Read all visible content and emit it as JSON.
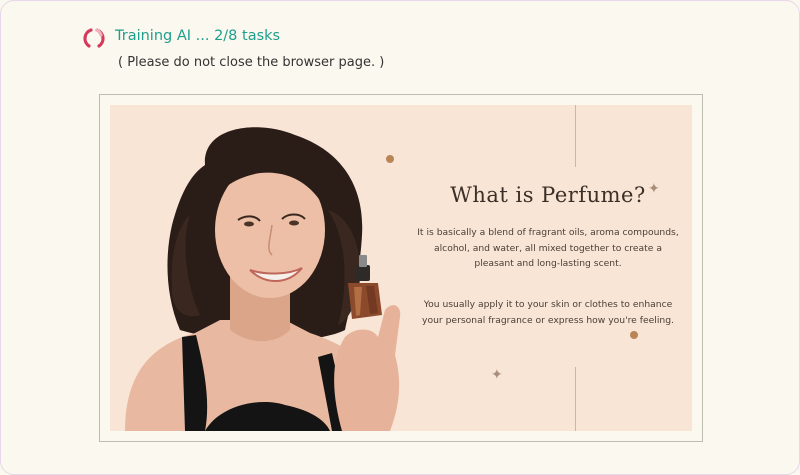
{
  "status": {
    "label": "Training AI ... 2/8 tasks",
    "note": "( Please do not close the browser page. )",
    "accent_color": "#1e9e8d",
    "spinner_colors": [
      "#d43a5a",
      "#f0b0bd"
    ],
    "spinner_icon": "loading-spinner-icon"
  },
  "slide": {
    "title": "What is Perfume?",
    "paragraph1": "It is basically a blend of fragrant oils, aroma compounds, alcohol, and water, all mixed together to create a pleasant and long-lasting scent.",
    "paragraph2": "You usually apply it to your skin or clothes to enhance your personal fragrance or express how you're feeling.",
    "background_color": "#f8e5d6",
    "accent_dot_color": "#b98456"
  }
}
